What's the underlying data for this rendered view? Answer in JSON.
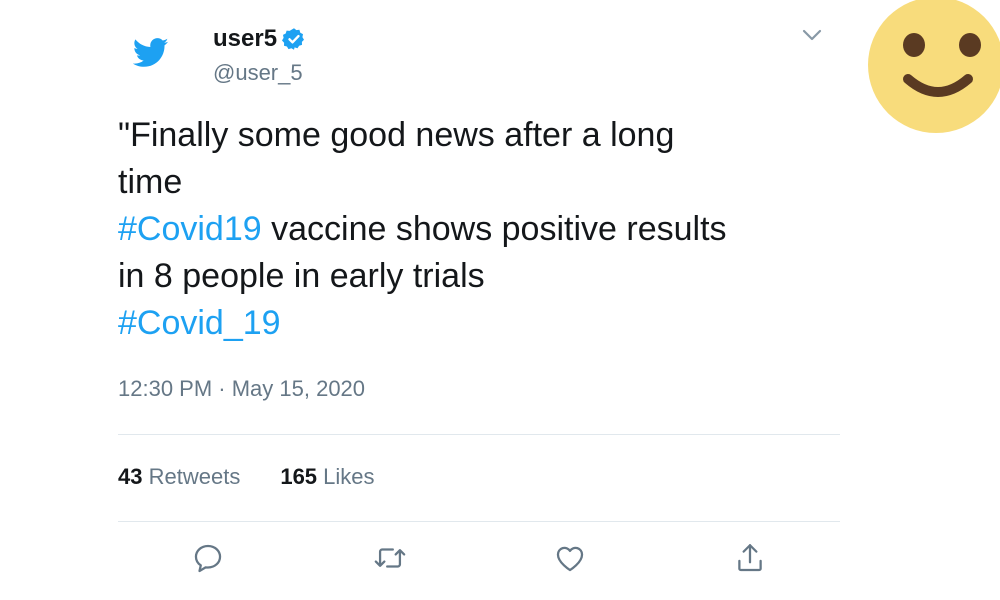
{
  "tweet": {
    "author": {
      "display_name": "user5",
      "handle": "@user_5",
      "verified": true
    },
    "text": {
      "line1": "\"Finally some good news after a long",
      "line2": "time",
      "hashtag1": "#Covid19",
      "line3_rest": " vaccine shows positive results",
      "line4": "in 8 people in early trials",
      "hashtag2": "#Covid_19"
    },
    "timestamp": "12:30 PM · May 15, 2020",
    "stats": {
      "retweets_count": "43",
      "retweets_label": "Retweets",
      "likes_count": "165",
      "likes_label": "Likes"
    },
    "actions": {
      "reply_icon": "reply-icon",
      "retweet_icon": "retweet-icon",
      "like_icon": "heart-icon",
      "share_icon": "share-icon"
    }
  },
  "overlay": {
    "emoji": "smiling-face"
  },
  "colors": {
    "brand_blue": "#1da1f2",
    "text_primary": "#14171a",
    "text_secondary": "#657786",
    "divider": "#e1e8ed",
    "emoji_yellow": "#f8dc7c",
    "emoji_features": "#5a3a22"
  }
}
